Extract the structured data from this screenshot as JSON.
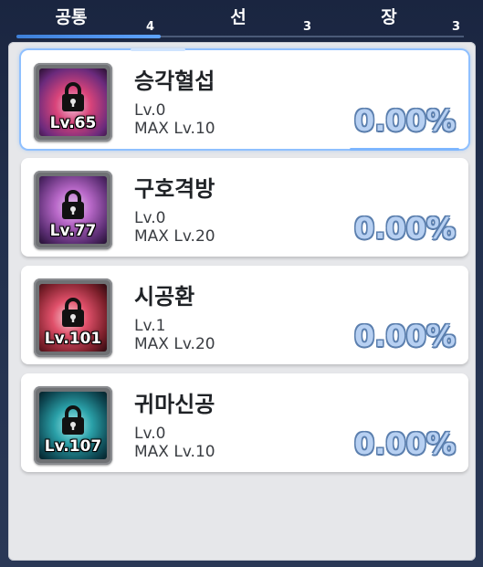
{
  "tabs": [
    {
      "label": "공통",
      "count": "4",
      "active": true
    },
    {
      "label": "선",
      "count": "3",
      "active": false
    },
    {
      "label": "장",
      "count": "3",
      "active": false
    }
  ],
  "skills": [
    {
      "name": "승각혈섭",
      "level_badge": "Lv.65",
      "current_level": "Lv.0",
      "max_level": "MAX Lv.10",
      "percent": "0.00%",
      "selected": true,
      "icon": "lock-icon",
      "art_colors": [
        "#6a2a7c",
        "#d9447a",
        "#f0c0d8"
      ]
    },
    {
      "name": "구호격방",
      "level_badge": "Lv.77",
      "current_level": "Lv.0",
      "max_level": "MAX Lv.20",
      "percent": "0.00%",
      "selected": false,
      "icon": "lock-icon",
      "art_colors": [
        "#5a2d72",
        "#b868c8",
        "#e8c8f0"
      ]
    },
    {
      "name": "시공환",
      "level_badge": "Lv.101",
      "current_level": "Lv.1",
      "max_level": "MAX Lv.20",
      "percent": "0.00%",
      "selected": false,
      "icon": "lock-icon",
      "art_colors": [
        "#7a1f2a",
        "#e0506a",
        "#f8d0d8"
      ]
    },
    {
      "name": "귀마신공",
      "level_badge": "Lv.107",
      "current_level": "Lv.0",
      "max_level": "MAX Lv.10",
      "percent": "0.00%",
      "selected": false,
      "icon": "lock-icon",
      "art_colors": [
        "#0f4a55",
        "#2aa0a8",
        "#a8f0f0"
      ]
    }
  ]
}
